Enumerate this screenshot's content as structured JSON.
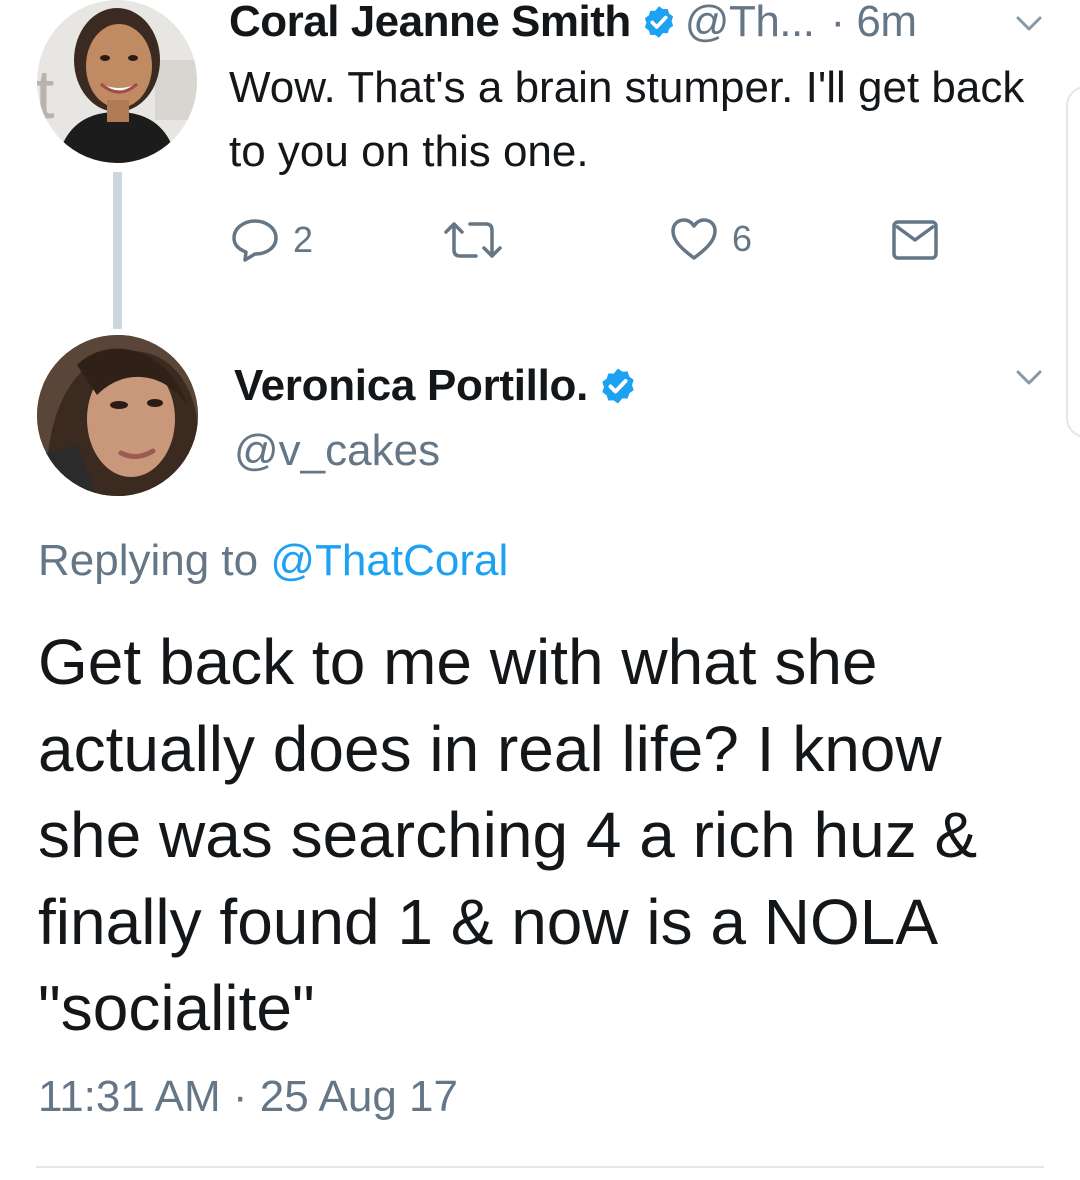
{
  "reply_tweet": {
    "author_name": "Coral Jeanne Smith",
    "handle": "@Th...",
    "time": "· 6m",
    "text": "Wow. That's a brain stumper. I'll get back to you on this one.",
    "reply_count": "2",
    "like_count": "6",
    "icons": [
      "verified-icon",
      "chevron-down-icon",
      "reply-icon",
      "retweet-icon",
      "heart-icon",
      "mail-icon"
    ]
  },
  "main_tweet": {
    "author_name": "Veronica Portillo.",
    "handle": "@v_cakes",
    "replying_prefix": "Replying to",
    "replying_to": "@ThatCoral",
    "text": "Get back to me with what she actually does in real life? I know she was searching 4 a rich huz & finally found 1 & now is a NOLA \"socialite\"",
    "time": "11:31 AM",
    "separator": "·",
    "date": "25 Aug 17"
  },
  "colors": {
    "text": "#14171a",
    "secondary": "#657786",
    "accent": "#1da1f2",
    "divider": "#e1e8ed",
    "thread_line": "#ccd6dd"
  }
}
